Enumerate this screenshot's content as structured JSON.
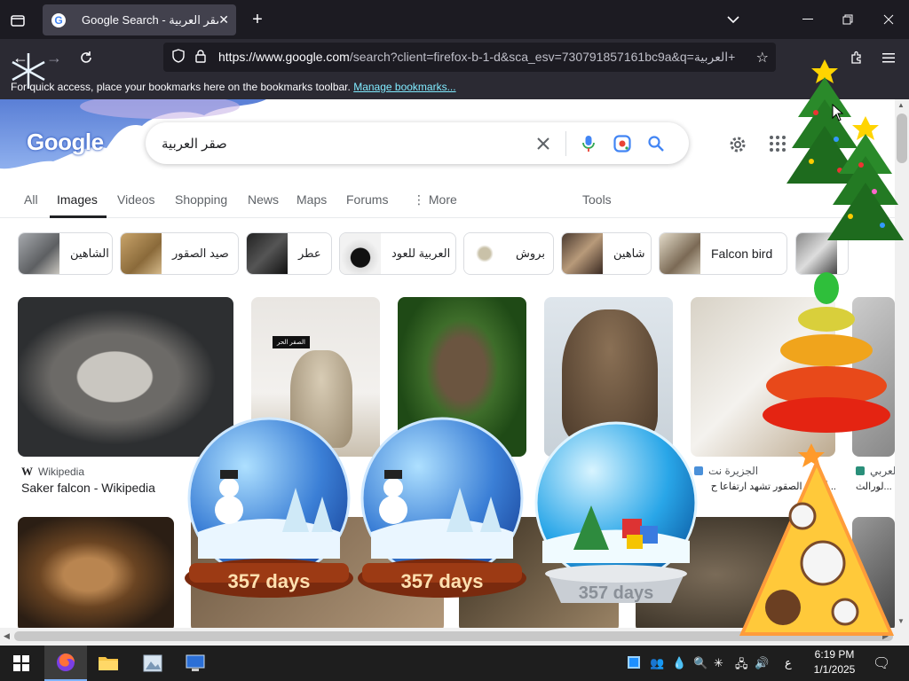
{
  "browser": {
    "tab_title": "Google Search - صقر العربية",
    "url_host": "https://www.google.com",
    "url_rest": "/search?client=firefox-b-1-d&sca_esv=730791857161bc9a&q=العربية+",
    "bookmarks_text": "For quick access, place your bookmarks here on the bookmarks toolbar.",
    "bookmarks_link": "Manage bookmarks..."
  },
  "search": {
    "logo": "Google",
    "query": "صقر العربية"
  },
  "tabs": [
    "All",
    "Images",
    "Videos",
    "Shopping",
    "News",
    "Maps",
    "Forums",
    "More",
    "Tools"
  ],
  "chips": [
    "الشاهين",
    "صيد الصقور",
    "عطر",
    "العربية للعود",
    "بروش",
    "شاهين",
    "Falcon bird"
  ],
  "results": {
    "r1_source": "Wikipedia",
    "r1_caption": "Saker falcon - Wikipedia",
    "thumb_badge": "الصقر الحر",
    "r5_source": "الجزيرة نت",
    "r5_caption": "...أسعار الصقور تشهد ارتفاعا ح",
    "r6_source": "العربي",
    "r6_caption": "...لورالث"
  },
  "decor": {
    "globe_text": "357 days"
  },
  "taskbar": {
    "time": "6:19 PM",
    "date": "1/1/2025",
    "lang": "ع"
  },
  "colors": {
    "chrome_dark": "#1c1b22",
    "toolbar": "#2b2a33",
    "link": "#80ebff",
    "google_blue": "#4285f4"
  }
}
